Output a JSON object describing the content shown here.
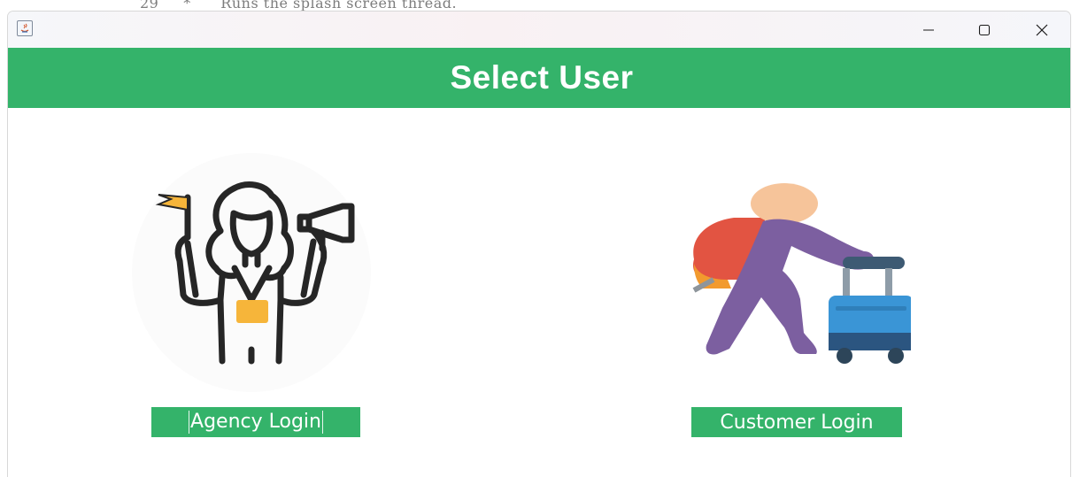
{
  "background": {
    "editor_text": "29     *      Runs the splash screen thread."
  },
  "window": {
    "title": "",
    "controls": {
      "minimize": "minimize-icon",
      "maximize": "maximize-icon",
      "close": "close-icon"
    }
  },
  "header": {
    "title": "Select User",
    "color": "#34b36a"
  },
  "options": {
    "agency": {
      "label": "Agency Login",
      "illustration": "tour-guide-with-flag-and-megaphone"
    },
    "customer": {
      "label": "Customer Login",
      "illustration": "traveler-with-backpack-and-suitcase"
    }
  },
  "colors": {
    "accent": "#34b36a",
    "button_text": "#ffffff"
  }
}
